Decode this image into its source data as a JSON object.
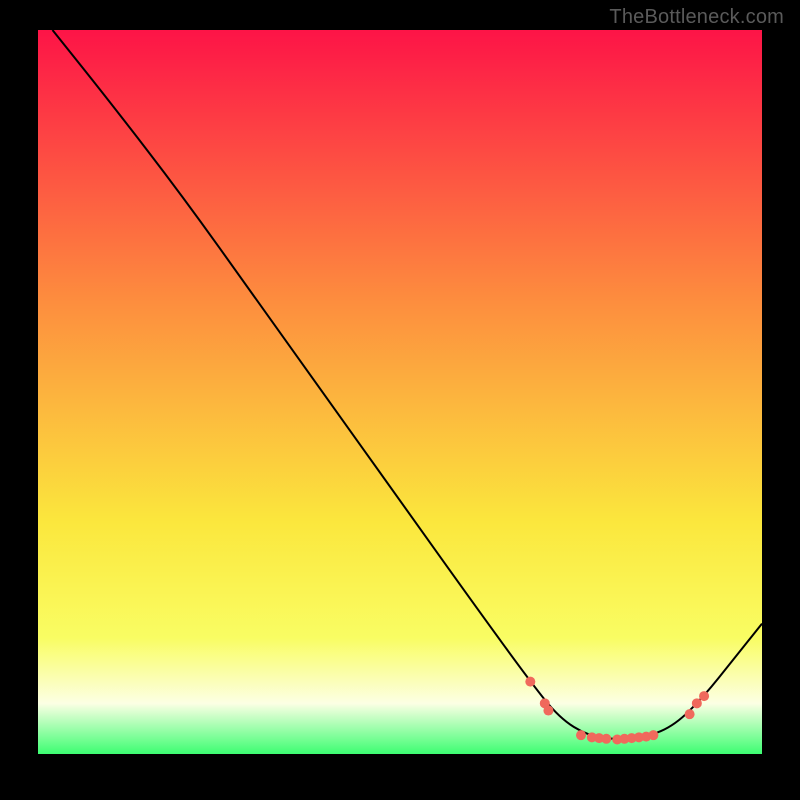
{
  "attribution": "TheBottleneck.com",
  "colors": {
    "gradient_top": "#fd1447",
    "gradient_mid_orange": "#fd8f3e",
    "gradient_mid_yellow": "#fbe73d",
    "gradient_lower_yellow": "#f9fd63",
    "gradient_cream": "#fcffe4",
    "gradient_bottom": "#3dfd72",
    "curve": "#000000",
    "markers": "#f0695c",
    "background": "#000000"
  },
  "chart_data": {
    "type": "line",
    "title": "",
    "xlabel": "",
    "ylabel": "",
    "xlim": [
      0,
      100
    ],
    "ylim": [
      0,
      100
    ],
    "curve": [
      {
        "x": 2,
        "y": 100
      },
      {
        "x": 10,
        "y": 90
      },
      {
        "x": 20,
        "y": 77
      },
      {
        "x": 30,
        "y": 63
      },
      {
        "x": 40,
        "y": 49
      },
      {
        "x": 50,
        "y": 35
      },
      {
        "x": 60,
        "y": 21
      },
      {
        "x": 68,
        "y": 10
      },
      {
        "x": 72,
        "y": 5
      },
      {
        "x": 76,
        "y": 2.5
      },
      {
        "x": 80,
        "y": 2
      },
      {
        "x": 84,
        "y": 2.3
      },
      {
        "x": 88,
        "y": 4
      },
      {
        "x": 92,
        "y": 8
      },
      {
        "x": 96,
        "y": 13
      },
      {
        "x": 100,
        "y": 18
      }
    ],
    "markers": [
      {
        "x": 68,
        "y": 10
      },
      {
        "x": 70,
        "y": 7
      },
      {
        "x": 70.5,
        "y": 6
      },
      {
        "x": 75,
        "y": 2.6
      },
      {
        "x": 76.5,
        "y": 2.3
      },
      {
        "x": 77.5,
        "y": 2.2
      },
      {
        "x": 78.5,
        "y": 2.1
      },
      {
        "x": 80,
        "y": 2.0
      },
      {
        "x": 81,
        "y": 2.1
      },
      {
        "x": 82,
        "y": 2.2
      },
      {
        "x": 83,
        "y": 2.3
      },
      {
        "x": 84,
        "y": 2.4
      },
      {
        "x": 85,
        "y": 2.6
      },
      {
        "x": 90,
        "y": 5.5
      },
      {
        "x": 91,
        "y": 7
      },
      {
        "x": 92,
        "y": 8
      }
    ]
  }
}
